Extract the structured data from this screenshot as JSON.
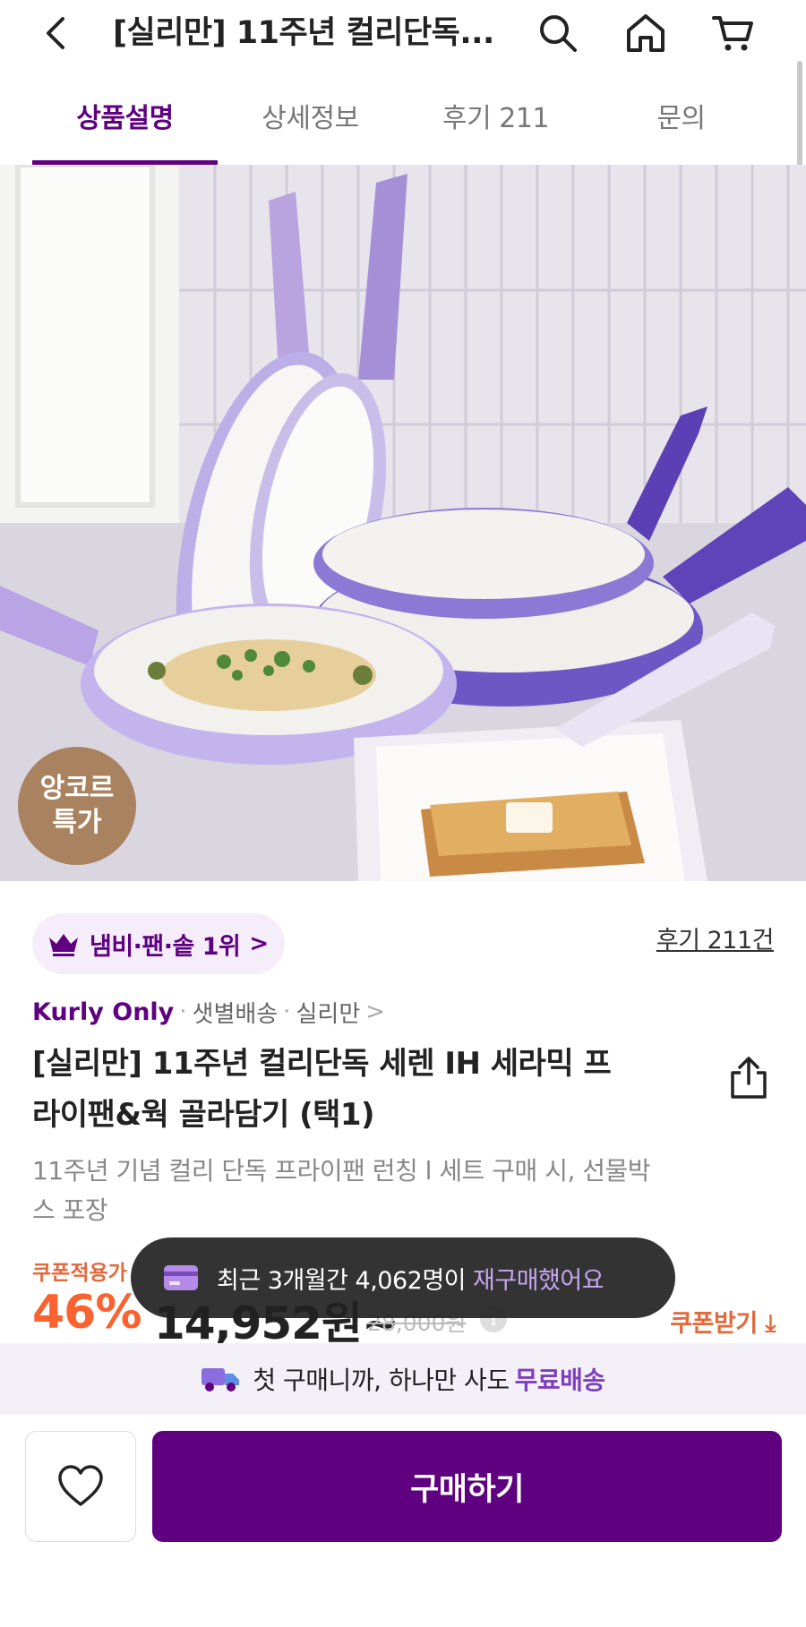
{
  "header": {
    "title": "[실리만] 11주년 컬리단독...",
    "icons": [
      "back-icon",
      "search-icon",
      "home-icon",
      "cart-icon"
    ]
  },
  "tabs": [
    {
      "label": "상품설명",
      "active": true
    },
    {
      "label": "상세정보",
      "active": false
    },
    {
      "label": "후기 211",
      "active": false
    },
    {
      "label": "문의",
      "active": false
    }
  ],
  "hero": {
    "badge_line1": "앙코르",
    "badge_line2": "특가"
  },
  "product": {
    "rank_chip": "냄비·팬·솥 1위",
    "review_link": "후기 211건",
    "kurly_only": "Kurly Only",
    "meta_delivery": "샛별배송",
    "meta_brand": "실리만",
    "title_line1": "[실리만] 11주년 컬리단독 세렌 IH 세라믹 프",
    "title_line2": "라이팬&웍 골라담기 (택1)",
    "desc_line1": "11주년 기념 컬리 단독 프라이팬 런칭 l 세트 구매 시, 선물박",
    "desc_line2": "스 포장"
  },
  "price": {
    "coupon_label": "쿠폰적용가",
    "discount_rate": "46%",
    "sale_price": "14,952원~",
    "original_price": "28,000원",
    "coupon_get": "쿠폰받기 ⤓"
  },
  "toast": {
    "text": "최근 3개월간 4,062명이",
    "highlight": "재구매했어요"
  },
  "free_shipping": {
    "text": "첫 구매니까, 하나만 사도",
    "highlight": "무료배송"
  },
  "bottom": {
    "buy_label": "구매하기"
  },
  "colors": {
    "brand_purple": "#5f0080",
    "discount_orange": "#fa622f",
    "badge_brown": "#a98360"
  }
}
